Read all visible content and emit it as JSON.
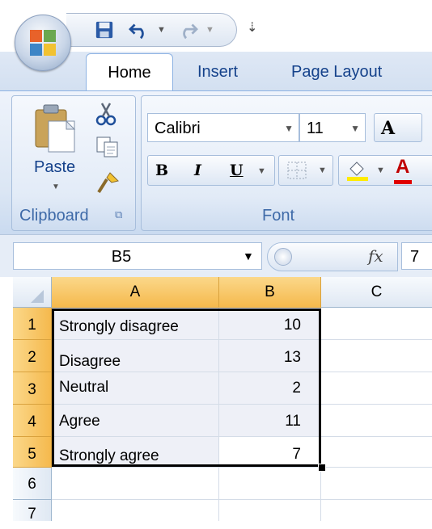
{
  "ribbon": {
    "tabs": [
      "Home",
      "Insert",
      "Page Layout"
    ],
    "active_tab": "Home",
    "clipboard": {
      "paste_label": "Paste",
      "group_label": "Clipboard"
    },
    "font": {
      "family": "Calibri",
      "size": "11",
      "group_label": "Font",
      "bold": "B",
      "italic": "I",
      "underline": "U",
      "grow": "A",
      "color_letter": "A"
    }
  },
  "formula_bar": {
    "name_box": "B5",
    "fx": "fx",
    "formula_value": "7"
  },
  "sheet": {
    "columns": [
      "A",
      "B",
      "C"
    ],
    "row_numbers": [
      "1",
      "2",
      "3",
      "4",
      "5",
      "6",
      "7"
    ],
    "rows": [
      {
        "a": "Strongly disagree",
        "b": "10"
      },
      {
        "a": "Disagree",
        "b": "13"
      },
      {
        "a": "Neutral",
        "b": "2"
      },
      {
        "a": "Agree",
        "b": "11"
      },
      {
        "a": "Strongly agree",
        "b": "7"
      }
    ]
  },
  "colors": {
    "selection_header": "#f5b94d",
    "ribbon_blue": "#dbe6f4",
    "label_blue": "#3e6aa8"
  }
}
